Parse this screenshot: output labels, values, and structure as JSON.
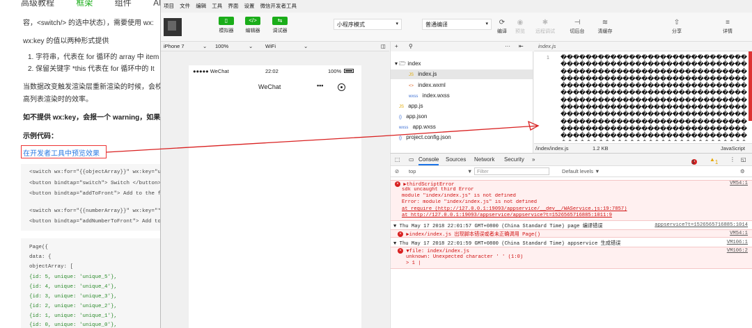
{
  "doc": {
    "topnav": [
      "高级教程",
      "框架",
      "组件",
      "API"
    ],
    "line1": "容，<switch/> 的选中状态），需要使用 wx:",
    "line2": "wx:key 的值以两种形式提供",
    "list1": "1. 字符串，代表在 for 循环的 array 中 item",
    "list2": "2. 保留关键字 *this 代表在 for 循环中的 It",
    "para1": "当数据改变触发渲染层重新渲染的时候，会校正",
    "para2": "高列表渲染时的效率。",
    "warn": "如不提供 wx:key，会报一个 warning，如果",
    "example_title": "示例代码：",
    "preview_link": "在开发者工具中预览效果",
    "code1": [
      "<switch wx:for=\"{{objectArray}}\" wx:key=\"u",
      "<button bindtap=\"switch\"> Switch </button>",
      "<button bindtap=\"addToFront\"> Add to the f",
      "",
      "<switch wx:for=\"{{numberArray}}\" wx:key=\"*",
      "<button bindtap=\"addNumberToFront\"> Add to"
    ],
    "code2": [
      "Page({",
      "  data: {",
      "    objectArray: [",
      "      {id: 5, unique: 'unique_5'},",
      "      {id: 4, unique: 'unique_4'},",
      "      {id: 3, unique: 'unique_3'},",
      "      {id: 2, unique: 'unique_2'},",
      "      {id: 1, unique: 'unique_1'},",
      "      {id: 0, unique: 'unique_0'},"
    ]
  },
  "ide": {
    "menu": [
      "项目",
      "文件",
      "编辑",
      "工具",
      "界面",
      "设置",
      "微信开发者工具"
    ],
    "toolbar": {
      "simulator": "模拟器",
      "editor": "编辑器",
      "debugger": "调试器",
      "mode": "小程序模式",
      "compile_mode": "普通编译",
      "compile": "编译",
      "preview": "预览",
      "remote_debug": "远程调试",
      "background": "切后台",
      "clear_cache": "清缓存",
      "share": "分享",
      "details": "详情"
    },
    "simulator": {
      "device": "iPhone 7",
      "zoom": "100%",
      "network": "WiFi",
      "carrier": "●●●●● WeChat",
      "time": "22:02",
      "battery": "100%",
      "title": "WeChat",
      "more": "•••"
    },
    "tree": {
      "add": "+",
      "more": "···",
      "items": [
        {
          "name": "index",
          "ext": "",
          "kind": "folder"
        },
        {
          "name": "index.js",
          "ext": "JS",
          "kind": "js"
        },
        {
          "name": "index.wxml",
          "ext": "<>",
          "kind": "wxml"
        },
        {
          "name": "index.wxss",
          "ext": "wxss",
          "kind": "wxss"
        },
        {
          "name": "app.js",
          "ext": "JS",
          "kind": "js"
        },
        {
          "name": "app.json",
          "ext": "{}",
          "kind": "json"
        },
        {
          "name": "app.wxss",
          "ext": "wxss",
          "kind": "wxss"
        },
        {
          "name": "project.config.json",
          "ext": "{}",
          "kind": "json"
        }
      ]
    },
    "editor": {
      "tab": "index.js",
      "line_no": "1",
      "garbage": "��������������������������������������������������������������������������������������������������������������������������������������������������������������������������������������������������������������������������������������������������������������������������������������������������������������������������������������������������������������������������������������������������������",
      "path": "/index/index.js",
      "size": "1.2 KB",
      "lang": "JavaScript"
    },
    "console": {
      "tabs": [
        "Console",
        "Sources",
        "Network",
        "Security",
        "»"
      ],
      "context": "top",
      "filter_placeholder": "Filter",
      "levels": "Default levels ▼",
      "err_count": "3",
      "warn_count": "1",
      "lines": [
        {
          "text": "▶thirdScriptError",
          "src": "VM54:1",
          "kind": "err"
        },
        {
          "text": "sdk uncaught third Error",
          "src": "",
          "kind": "err"
        },
        {
          "text": "module \"index/index.js\" is not defined",
          "src": "",
          "kind": "err"
        },
        {
          "text": "Error: module \"index/index.js\" is not defined",
          "src": "",
          "kind": "err"
        },
        {
          "text": "    at require (http://127.0.0.1:19093/appservice/__dev__/WAService.js:19:7857)",
          "src": "",
          "kind": "err"
        },
        {
          "text": "    at http://127.0.0.1:19093/appservice/appservice?t=1526565716885:1011:9",
          "src": "",
          "kind": "err"
        },
        {
          "text": "▼ Thu May 17 2018 22:01:57 GMT+0800 (China Standard Time) page 编译错误",
          "src": "appservice?t=1526565716885:1014",
          "kind": "info"
        },
        {
          "text": "▶index/index.js 出现脚本错误或者未正确调用 Page()",
          "src": "VM54:1",
          "kind": "err"
        },
        {
          "text": "▼ Thu May 17 2018 22:01:59 GMT+0800 (China Standard Time)  appservice 生成错误",
          "src": "VM106:1",
          "kind": "info"
        },
        {
          "text": "▼file: index/index.js",
          "src": "VM106:2",
          "kind": "err"
        },
        {
          "text": " unknown: Unexpected character '  ' (1:0)",
          "src": "",
          "kind": "err"
        },
        {
          "text": " > 1 |",
          "src": "",
          "kind": "err"
        }
      ]
    }
  },
  "colors": {
    "green": "#1aad19",
    "error": "#d01010",
    "link": "#2a7ae2"
  }
}
